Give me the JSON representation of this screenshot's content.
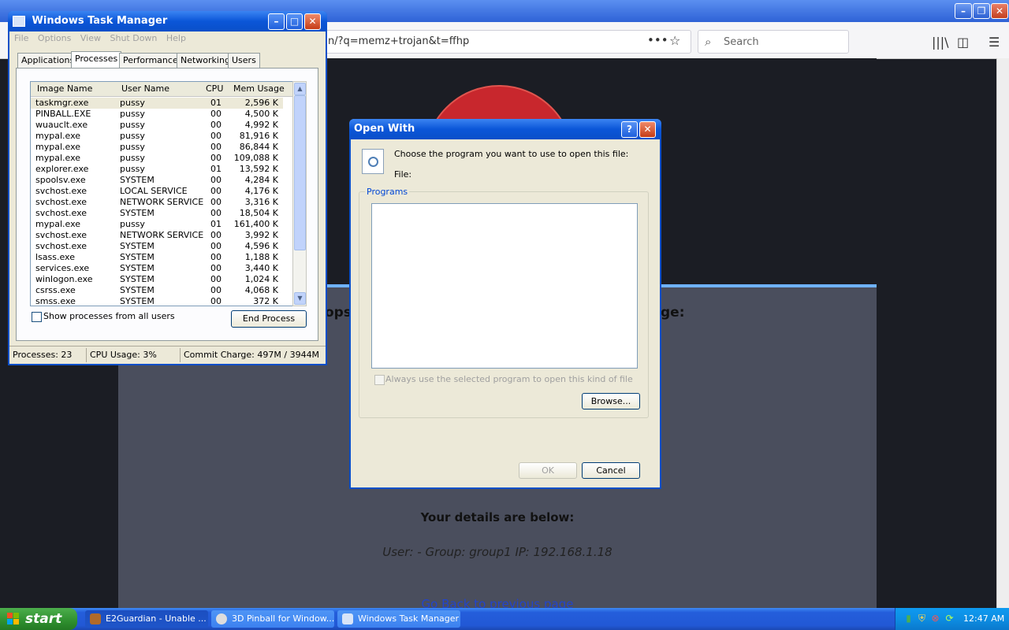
{
  "browser": {
    "url_fragment": "n/?q=memz+trojan&t=ffhp",
    "search_placeholder": "Search",
    "more_icon": "•••",
    "star_icon": "☆"
  },
  "page": {
    "oops_fragment": "ops",
    "heading_fragment": "ge:",
    "details_heading": "Your details are below:",
    "details_line": "User: -   Group: group1   IP: 192.168.1.18",
    "go_back": "Go Back to previous page"
  },
  "task_manager": {
    "title": "Windows Task Manager",
    "menu": [
      "File",
      "Options",
      "View",
      "Shut Down",
      "Help"
    ],
    "tabs": [
      "Applications",
      "Processes",
      "Performance",
      "Networking",
      "Users"
    ],
    "active_tab": "Processes",
    "columns": [
      "Image Name",
      "User Name",
      "CPU",
      "Mem Usage"
    ],
    "rows": [
      [
        "taskmgr.exe",
        "pussy",
        "01",
        "2,596 K"
      ],
      [
        "PINBALL.EXE",
        "pussy",
        "00",
        "4,500 K"
      ],
      [
        "wuauclt.exe",
        "pussy",
        "00",
        "4,992 K"
      ],
      [
        "mypal.exe",
        "pussy",
        "00",
        "81,916 K"
      ],
      [
        "mypal.exe",
        "pussy",
        "00",
        "86,844 K"
      ],
      [
        "mypal.exe",
        "pussy",
        "00",
        "109,088 K"
      ],
      [
        "explorer.exe",
        "pussy",
        "01",
        "13,592 K"
      ],
      [
        "spoolsv.exe",
        "SYSTEM",
        "00",
        "4,284 K"
      ],
      [
        "svchost.exe",
        "LOCAL SERVICE",
        "00",
        "4,176 K"
      ],
      [
        "svchost.exe",
        "NETWORK SERVICE",
        "00",
        "3,316 K"
      ],
      [
        "svchost.exe",
        "SYSTEM",
        "00",
        "18,504 K"
      ],
      [
        "mypal.exe",
        "pussy",
        "01",
        "161,400 K"
      ],
      [
        "svchost.exe",
        "NETWORK SERVICE",
        "00",
        "3,992 K"
      ],
      [
        "svchost.exe",
        "SYSTEM",
        "00",
        "4,596 K"
      ],
      [
        "lsass.exe",
        "SYSTEM",
        "00",
        "1,188 K"
      ],
      [
        "services.exe",
        "SYSTEM",
        "00",
        "3,440 K"
      ],
      [
        "winlogon.exe",
        "SYSTEM",
        "00",
        "1,024 K"
      ],
      [
        "csrss.exe",
        "SYSTEM",
        "00",
        "4,068 K"
      ],
      [
        "smss.exe",
        "SYSTEM",
        "00",
        "372 K"
      ]
    ],
    "show_all_label": "Show processes from all users",
    "end_process_label": "End Process",
    "status": {
      "processes": "Processes: 23",
      "cpu": "CPU Usage: 3%",
      "commit": "Commit Charge: 497M / 3944M"
    }
  },
  "open_with": {
    "title": "Open With",
    "help_label": "?",
    "prompt": "Choose the program you want to use to open this file:",
    "file_label": "File:",
    "programs_label": "Programs",
    "always_label": "Always use the selected program to open this kind of file",
    "browse_label": "Browse...",
    "ok_label": "OK",
    "cancel_label": "Cancel"
  },
  "taskbar": {
    "start_label": "start",
    "buttons": [
      {
        "label": "E2Guardian - Unable ...",
        "icon": "browser-icon"
      },
      {
        "label": "3D Pinball for Window...",
        "icon": "pinball-icon"
      },
      {
        "label": "Windows Task Manager",
        "icon": "task-manager-icon"
      }
    ],
    "time": "12:47 AM"
  }
}
